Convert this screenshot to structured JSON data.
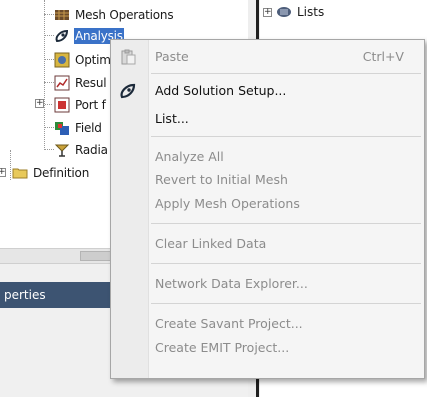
{
  "tree": {
    "items": [
      {
        "label": "Mesh Operations",
        "icon": "mesh-operations-icon"
      },
      {
        "label": "Analysis",
        "icon": "analysis-setup-icon"
      },
      {
        "label": "Optim",
        "icon": "optimetrics-icon"
      },
      {
        "label": "Resul",
        "icon": "results-icon"
      },
      {
        "label": "Port f",
        "icon": "port-field-display-icon"
      },
      {
        "label": "Field",
        "icon": "field-overlays-icon"
      },
      {
        "label": "Radia",
        "icon": "radiation-icon"
      },
      {
        "label": "Definition",
        "icon": "folder-icon"
      }
    ]
  },
  "right_panel": {
    "lists_label": "Lists",
    "lists_icon": "lists-icon"
  },
  "properties": {
    "title": "perties"
  },
  "context_menu": {
    "items": [
      {
        "label": "Paste",
        "shortcut": "Ctrl+V",
        "enabled": false,
        "icon": "paste-icon"
      },
      {
        "label": "Add Solution Setup...",
        "shortcut": "",
        "enabled": true,
        "icon": "add-solution-setup-icon"
      },
      {
        "label": "List...",
        "shortcut": "",
        "enabled": true,
        "icon": ""
      },
      {
        "label": "Analyze All",
        "shortcut": "",
        "enabled": false,
        "icon": ""
      },
      {
        "label": "Revert to Initial Mesh",
        "shortcut": "",
        "enabled": false,
        "icon": ""
      },
      {
        "label": "Apply Mesh Operations",
        "shortcut": "",
        "enabled": false,
        "icon": ""
      },
      {
        "label": "Clear Linked Data",
        "shortcut": "",
        "enabled": false,
        "icon": ""
      },
      {
        "label": "Network Data Explorer...",
        "shortcut": "",
        "enabled": false,
        "icon": ""
      },
      {
        "label": "Create Savant Project...",
        "shortcut": "",
        "enabled": false,
        "icon": ""
      },
      {
        "label": "Create EMIT Project...",
        "shortcut": "",
        "enabled": false,
        "icon": ""
      }
    ]
  },
  "colors": {
    "selection": "#3a72c8",
    "properties_header": "#3d5472",
    "menu_background": "#f5f5f5",
    "disabled_text": "#8c8c8c"
  }
}
